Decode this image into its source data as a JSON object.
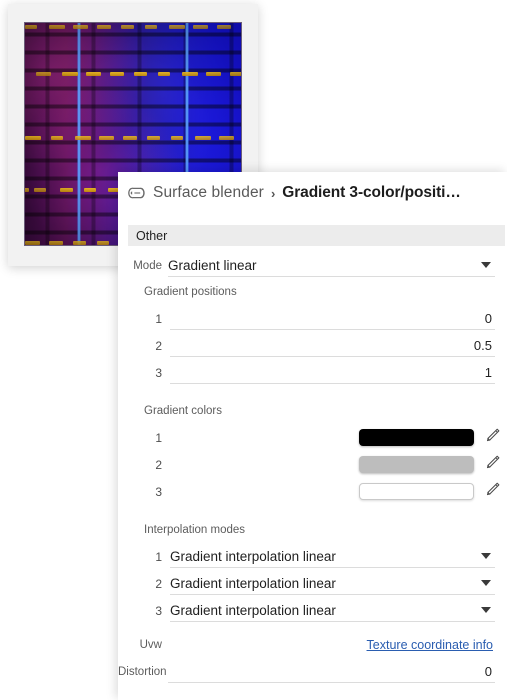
{
  "preview": {
    "name": "texture-preview",
    "description": "Procedural brick weave texture preview, purple to blue with gold dashes"
  },
  "breadcrumb": {
    "icon": "surface-blender-icon",
    "parent": "Surface blender",
    "separator": "›",
    "current": "Gradient 3-color/positi…"
  },
  "section": {
    "header": "Other"
  },
  "mode": {
    "label": "Mode",
    "value": "Gradient linear",
    "caret": "chevron-down-icon"
  },
  "gradient_positions": {
    "label": "Gradient positions",
    "items": [
      {
        "index": "1",
        "value": "0"
      },
      {
        "index": "2",
        "value": "0.5"
      },
      {
        "index": "3",
        "value": "1"
      }
    ]
  },
  "gradient_colors": {
    "label": "Gradient colors",
    "edit_icon": "pencil-icon",
    "items": [
      {
        "index": "1",
        "color": "#000000"
      },
      {
        "index": "2",
        "color": "#bdbdbd"
      },
      {
        "index": "3",
        "color": "#ffffff"
      }
    ]
  },
  "interpolation_modes": {
    "label": "Interpolation modes",
    "items": [
      {
        "index": "1",
        "value": "Gradient interpolation linear"
      },
      {
        "index": "2",
        "value": "Gradient interpolation linear"
      },
      {
        "index": "3",
        "value": "Gradient interpolation linear"
      }
    ]
  },
  "uvw": {
    "label": "Uvw",
    "link": "Texture coordinate info"
  },
  "distortion": {
    "label": "Distortion",
    "value": "0"
  },
  "colors": {
    "panel_bg": "#ffffff",
    "section_bg": "#ececec",
    "label_text": "#5c5c5c",
    "value_text": "#1f1f1f",
    "link": "#2a5db0",
    "underline": "#dcdcdc"
  }
}
